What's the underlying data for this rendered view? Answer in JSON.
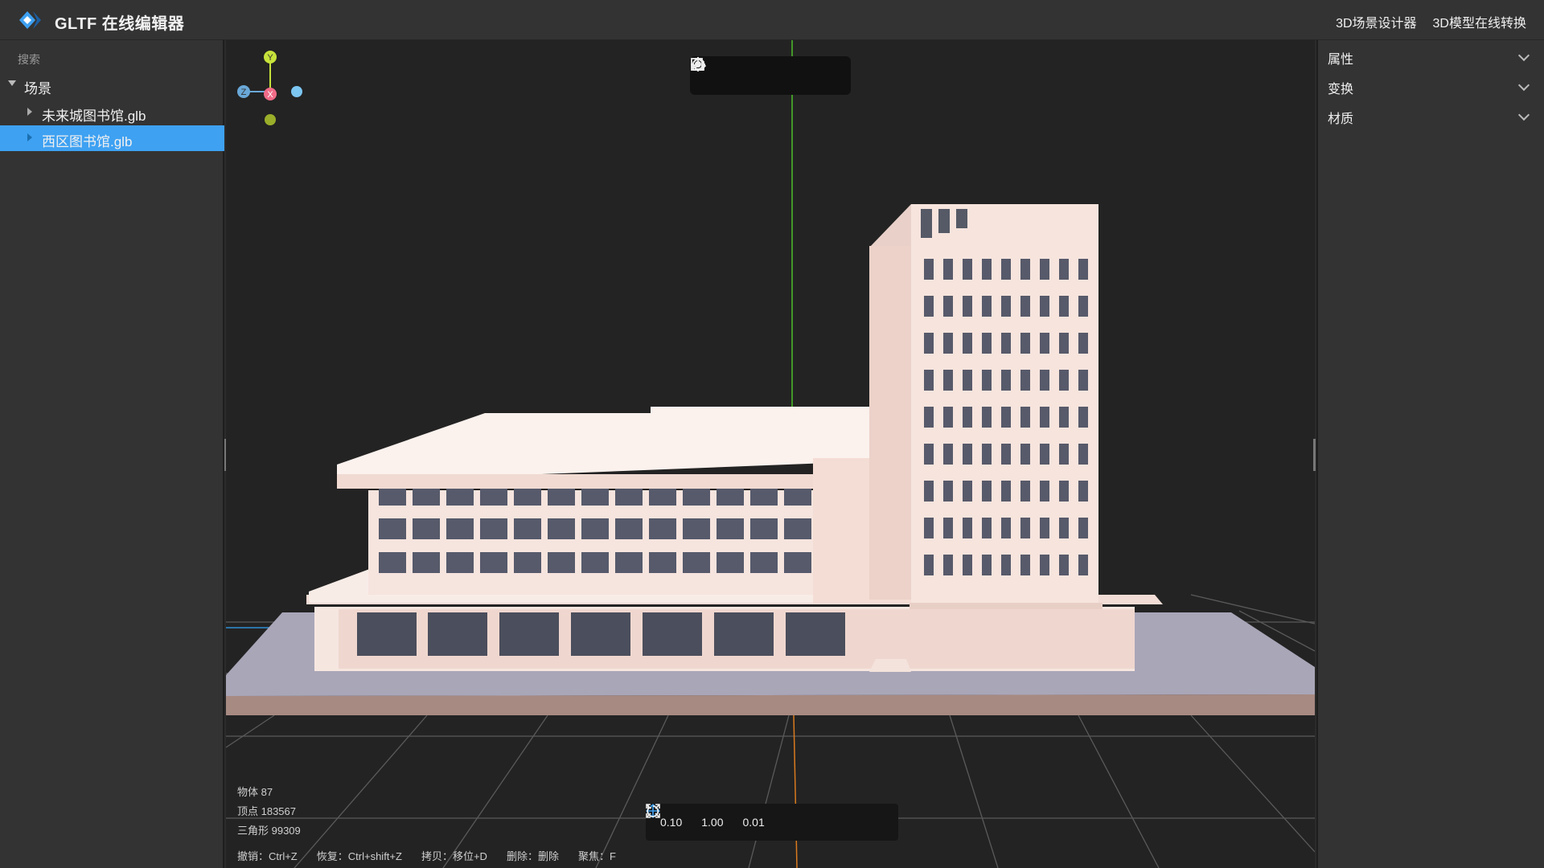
{
  "app": {
    "title": "GLTF 在线编辑器",
    "brand_color": "#3ea1f2"
  },
  "top_links": [
    {
      "label": "3D场景设计器"
    },
    {
      "label": "3D模型在线转换"
    }
  ],
  "left_panel": {
    "search_label": "搜索",
    "root": {
      "label": "场景",
      "expanded": true
    },
    "items": [
      {
        "label": "未来城图书馆.glb",
        "selected": false
      },
      {
        "label": "西区图书馆.glb",
        "selected": true
      }
    ]
  },
  "viewport": {
    "toolbar_icons": [
      "import-icon",
      "replace-model-icon",
      "focus-icon",
      "reset-icon",
      "export-icon"
    ],
    "stats": {
      "objects": "物体 87",
      "vertices": "顶点 183567",
      "triangles": "三角形 99309"
    },
    "shortcuts": [
      "撤销：Ctrl+Z",
      "恢复：Ctrl+shift+Z",
      "拷贝：移位+D",
      "删除：删除",
      "聚焦：F"
    ],
    "transform_bar": {
      "translate_step": "0.10",
      "rotate_step": "1.00",
      "scale_step": "0.01"
    },
    "gizmo": {
      "y_label": "Y",
      "x_label": "X",
      "z_label": "Z",
      "y_color": "#c7e23a",
      "x_color": "#f06b88",
      "z_color": "#6aa8d8"
    }
  },
  "right_panel": {
    "sections": [
      {
        "label": "属性"
      },
      {
        "label": "变换"
      },
      {
        "label": "材质"
      }
    ]
  }
}
